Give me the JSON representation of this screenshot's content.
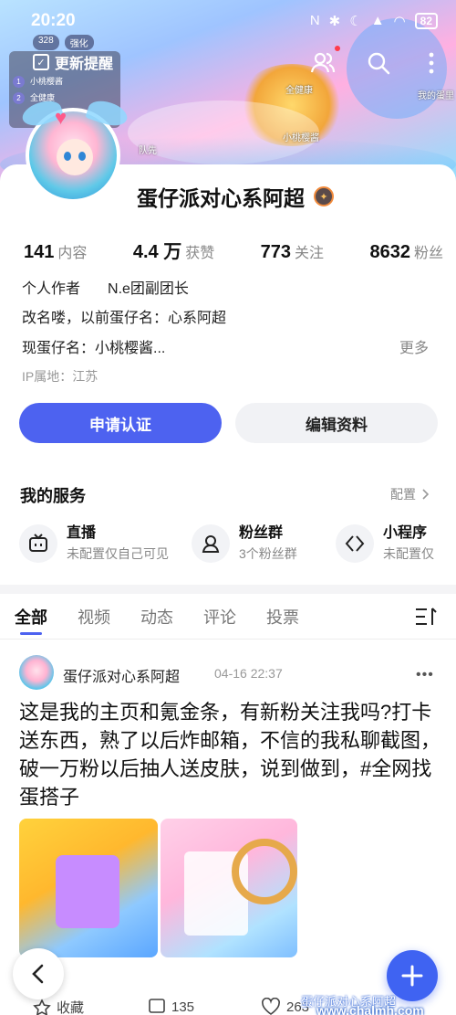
{
  "status_bar": {
    "time": "20:20",
    "battery": "82"
  },
  "game_hud": {
    "coins": "328",
    "upgrade": "强化"
  },
  "notification": {
    "label": "更新提醒"
  },
  "mini_list": [
    {
      "num": "1",
      "label": "小桃樱酱"
    },
    {
      "num": "2",
      "label": "全健康"
    }
  ],
  "game_labels": {
    "healthy": "全健康",
    "player": "小桃樱酱",
    "my_egg": "我的蛋里",
    "team": "队先"
  },
  "profile": {
    "name": "蛋仔派对心系阿超",
    "stats": [
      {
        "value": "141",
        "label": "内容"
      },
      {
        "value": "4.4 万",
        "label": "获赞"
      },
      {
        "value": "773",
        "label": "关注"
      },
      {
        "value": "8632",
        "label": "粉丝"
      }
    ],
    "bio_line1_a": "个人作者",
    "bio_line1_b": "N.e团副团长",
    "bio_line2": "改名喽，以前蛋仔名：心系阿超",
    "bio_line3": "现蛋仔名：小桃樱酱...",
    "more": "更多",
    "ip": "IP属地：江苏",
    "btn_primary": "申请认证",
    "btn_secondary": "编辑资料"
  },
  "services": {
    "title": "我的服务",
    "config": "配置",
    "items": [
      {
        "title": "直播",
        "sub": "未配置仅自己可见",
        "icon": "tv-icon"
      },
      {
        "title": "粉丝群",
        "sub": "3个粉丝群",
        "icon": "group-icon"
      },
      {
        "title": "小程序",
        "sub": "未配置仅",
        "icon": "miniprogram-icon"
      }
    ]
  },
  "tabs": [
    "全部",
    "视频",
    "动态",
    "评论",
    "投票"
  ],
  "post": {
    "author": "蛋仔派对心系阿超",
    "time": "04-16 22:37",
    "text": "这是我的主页和氪金条，有新粉关注我吗?打卡送东西，熟了以后炸邮箱，不信的我私聊截图，破一万粉以后抽人送皮肤，说到做到，#全网找蛋搭子",
    "actions": {
      "fav": "收藏",
      "comments": "135",
      "likes": "263"
    }
  },
  "watermark": {
    "line1": "蛋仔派对心系阿超",
    "line2": "www.chalmh.com"
  },
  "colors": {
    "accent": "#4d62f0",
    "fab": "#3f63f2"
  }
}
